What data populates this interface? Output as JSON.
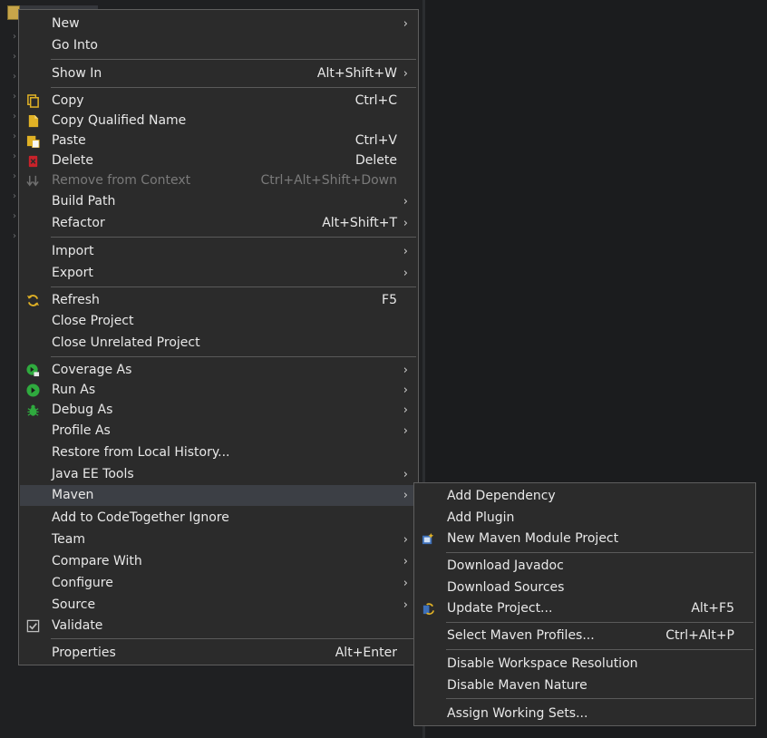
{
  "context_menu": {
    "items": [
      {
        "label": "New",
        "submenu": true
      },
      {
        "label": "Go Into"
      },
      {
        "label": "Show In",
        "shortcut": "Alt+Shift+W",
        "submenu": true
      },
      {
        "label": "Copy",
        "shortcut": "Ctrl+C",
        "icon": "copy-icon"
      },
      {
        "label": "Copy Qualified Name",
        "icon": "copy-qualified-name-icon"
      },
      {
        "label": "Paste",
        "shortcut": "Ctrl+V",
        "icon": "paste-icon"
      },
      {
        "label": "Delete",
        "shortcut": "Delete",
        "icon": "delete-icon"
      },
      {
        "label": "Remove from Context",
        "shortcut": "Ctrl+Alt+Shift+Down",
        "icon": "remove-from-context-icon",
        "disabled": true
      },
      {
        "label": "Build Path",
        "submenu": true
      },
      {
        "label": "Refactor",
        "shortcut": "Alt+Shift+T",
        "submenu": true
      },
      {
        "label": "Import",
        "submenu": true
      },
      {
        "label": "Export",
        "submenu": true
      },
      {
        "label": "Refresh",
        "shortcut": "F5",
        "icon": "refresh-icon"
      },
      {
        "label": "Close Project"
      },
      {
        "label": "Close Unrelated Project"
      },
      {
        "label": "Coverage As",
        "icon": "coverage-icon",
        "submenu": true
      },
      {
        "label": "Run As",
        "icon": "run-icon",
        "submenu": true
      },
      {
        "label": "Debug As",
        "icon": "debug-bug-icon",
        "submenu": true
      },
      {
        "label": "Profile As",
        "submenu": true
      },
      {
        "label": "Restore from Local History..."
      },
      {
        "label": "Java EE Tools",
        "submenu": true
      },
      {
        "label": "Maven",
        "submenu": true,
        "highlighted": true
      },
      {
        "label": "Add to CodeTogether Ignore"
      },
      {
        "label": "Team",
        "submenu": true
      },
      {
        "label": "Compare With",
        "submenu": true
      },
      {
        "label": "Configure",
        "submenu": true
      },
      {
        "label": "Source",
        "submenu": true
      },
      {
        "label": "Validate",
        "icon": "validate-check-icon"
      },
      {
        "label": "Properties",
        "shortcut": "Alt+Enter"
      }
    ]
  },
  "maven_submenu": {
    "items": [
      {
        "label": "Add Dependency"
      },
      {
        "label": "Add Plugin"
      },
      {
        "label": "New Maven Module Project",
        "icon": "new-maven-module-icon"
      },
      {
        "label": "Download Javadoc"
      },
      {
        "label": "Download Sources"
      },
      {
        "label": "Update Project...",
        "shortcut": "Alt+F5",
        "icon": "update-project-icon"
      },
      {
        "label": "Select Maven Profiles...",
        "shortcut": "Ctrl+Alt+P"
      },
      {
        "label": "Disable Workspace Resolution"
      },
      {
        "label": "Disable Maven Nature"
      },
      {
        "label": "Assign Working Sets..."
      }
    ]
  },
  "colors": {
    "menu_bg": "#2b2b2b",
    "highlight": "#3c3f45",
    "icon_yellow": "#e0b125",
    "icon_green": "#2faa3e",
    "icon_red": "#c8222a"
  }
}
